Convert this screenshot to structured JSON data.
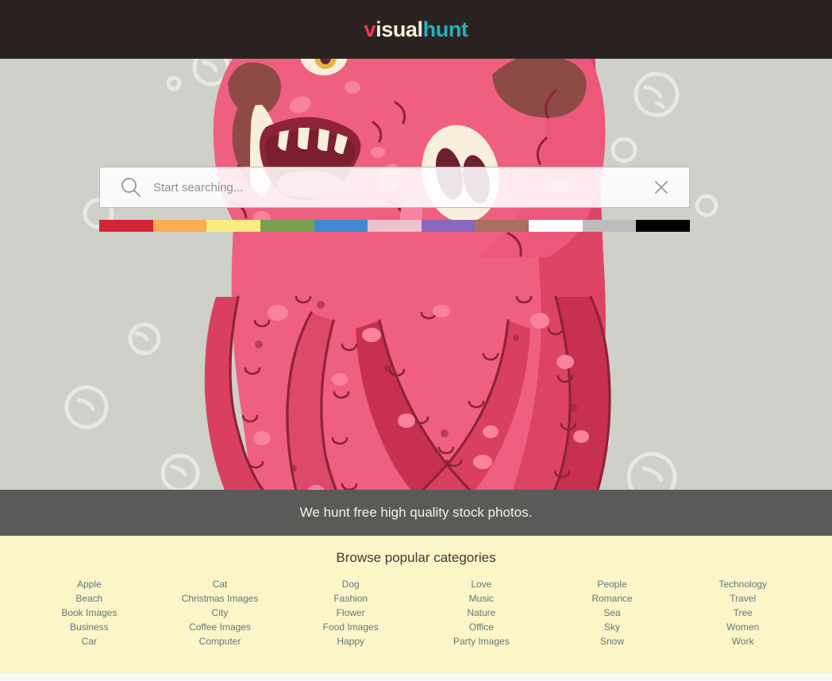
{
  "header": {
    "logo": {
      "part1": "v",
      "part2": "isual",
      "part3": "hunt",
      "color_part1": "#ef3b4e",
      "color_part2": "#f5f0dc",
      "color_part3": "#21b5bd",
      "background": "#2b2321"
    }
  },
  "search": {
    "placeholder": "Start searching...",
    "value": "",
    "search_icon": "magnifier-icon",
    "clear_icon": "close-icon"
  },
  "color_filter": {
    "label": "color-swatches",
    "swatches": [
      {
        "name": "red",
        "hex": "#d32535"
      },
      {
        "name": "orange",
        "hex": "#f9ad4e"
      },
      {
        "name": "yellow",
        "hex": "#fbec82"
      },
      {
        "name": "green",
        "hex": "#79a051"
      },
      {
        "name": "blue",
        "hex": "#4189d2"
      },
      {
        "name": "pink",
        "hex": "#eec1ce"
      },
      {
        "name": "purple",
        "hex": "#8968bc"
      },
      {
        "name": "brown",
        "hex": "#a8705f"
      },
      {
        "name": "white",
        "hex": "#ffffff"
      },
      {
        "name": "gray",
        "hex": "#bcbcbc"
      },
      {
        "name": "black",
        "hex": "#000000"
      }
    ]
  },
  "tagline": {
    "text": "We hunt free high quality stock photos.",
    "background": "rgba(45,45,45,0.78)",
    "text_color": "#f6f1e0"
  },
  "categories": {
    "title": "Browse popular categories",
    "background": "#fcf5c7",
    "link_color": "#5c7a80",
    "columns": [
      {
        "items": [
          "Apple",
          "Beach",
          "Book Images",
          "Business",
          "Car"
        ]
      },
      {
        "items": [
          "Cat",
          "Christmas Images",
          "City",
          "Coffee Images",
          "Computer"
        ]
      },
      {
        "items": [
          "Dog",
          "Fashion",
          "Flower",
          "Food Images",
          "Happy"
        ]
      },
      {
        "items": [
          "Love",
          "Music",
          "Nature",
          "Office",
          "Party Images"
        ]
      },
      {
        "items": [
          "People",
          "Romance",
          "Sea",
          "Sky",
          "Snow"
        ]
      },
      {
        "items": [
          "Technology",
          "Travel",
          "Tree",
          "Women",
          "Work"
        ]
      }
    ]
  },
  "hero": {
    "background": "#ced0c9",
    "illustration": "pink-monster-octopus-illustration",
    "monster_colors": {
      "body": "#ef5f80",
      "body_shadow": "#d9405f",
      "body_dark": "#c7304f",
      "outline": "#8e2338",
      "mouth": "#8e2338",
      "mouth_inner": "#7a1e30",
      "tongue": "#e4607e",
      "teeth": "#f7eedb",
      "eye_white": "#f7eedb",
      "pupil": "#6d2030",
      "horn": "#8e4a45",
      "spot_light": "#f9839c"
    },
    "bubble_color": "#e6e7e0"
  }
}
